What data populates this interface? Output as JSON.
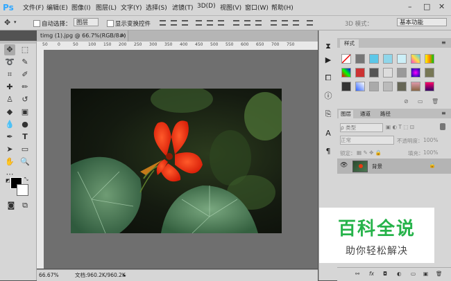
{
  "app": {
    "logo": "Ps"
  },
  "menu": [
    "文件(F)",
    "编辑(E)",
    "图像(I)",
    "图层(L)",
    "文字(Y)",
    "选择(S)",
    "滤镜(T)",
    "3D(D)",
    "视图(V)",
    "窗口(W)",
    "帮助(H)"
  ],
  "window_controls": {
    "minimize": "–",
    "maximize": "□",
    "close": "✕"
  },
  "options": {
    "auto_select_label": "自动选择：",
    "auto_select_value": "图层",
    "show_transform_label": "显示变换控件",
    "mode3d_label": "3D 模式：",
    "workspace": "基本功能"
  },
  "document": {
    "tab_title": "timg (1).jpg @ 66.7%(RGB/8#)",
    "close": "×",
    "zoom": "66.67%",
    "doc_info": "文档:960.2K/960.2K",
    "ruler_marks": [
      "50",
      "0",
      "50",
      "100",
      "150",
      "200",
      "250",
      "300",
      "350",
      "400",
      "450",
      "500",
      "550",
      "600",
      "650",
      "700",
      "750"
    ]
  },
  "styles_panel": {
    "tab": "样式"
  },
  "layers_panel": {
    "tabs": [
      "图层",
      "通道",
      "路径"
    ],
    "kind_label": "ρ 类型",
    "blend_mode": "正常",
    "opacity_label": "不透明度：",
    "opacity_value": "100%",
    "lock_label": "锁定：",
    "fill_label": "填充：",
    "fill_value": "100%",
    "layer_name": "背景",
    "footer_icons": [
      "⚯",
      "fx",
      "◘",
      "◐",
      "▭",
      "▣",
      "🗑"
    ]
  },
  "watermark": {
    "title": "百科全说",
    "subtitle": "助你轻松解决"
  },
  "colors": {
    "accent": "#31a8ff",
    "watermark_green": "#26b34a"
  }
}
